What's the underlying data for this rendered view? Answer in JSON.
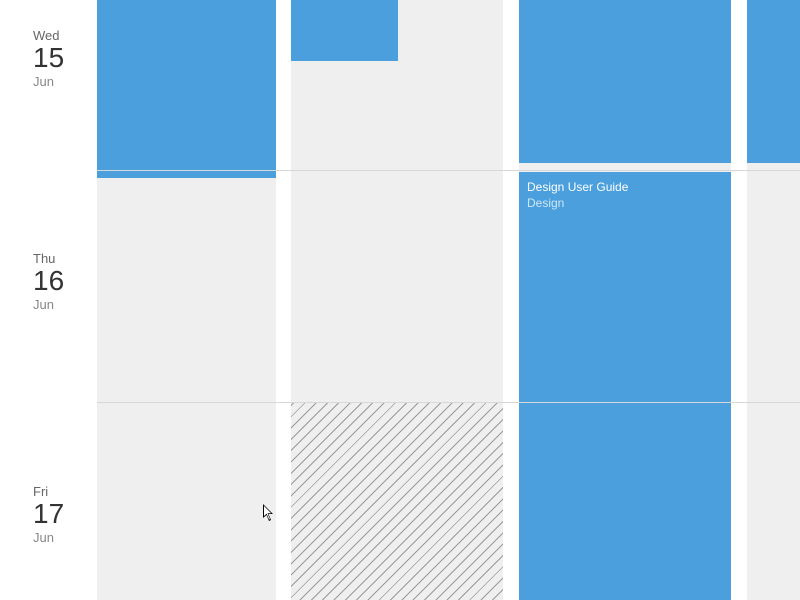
{
  "colors": {
    "event_bg": "#4a9fdc",
    "lane_bg": "#efefef",
    "divider": "#d8d8d8"
  },
  "days": [
    {
      "weekday": "Wed",
      "day": "15",
      "month": "Jun"
    },
    {
      "weekday": "Thu",
      "day": "16",
      "month": "Jun"
    },
    {
      "weekday": "Fri",
      "day": "17",
      "month": "Jun"
    }
  ],
  "events": {
    "e0": {
      "title": "",
      "sub": ""
    },
    "e1": {
      "title": "",
      "sub": ""
    },
    "e2": {
      "title": "",
      "sub": ""
    },
    "e3": {
      "title": "Design User Guide",
      "sub": "Design"
    },
    "e4": {
      "title": "",
      "sub": ""
    }
  }
}
